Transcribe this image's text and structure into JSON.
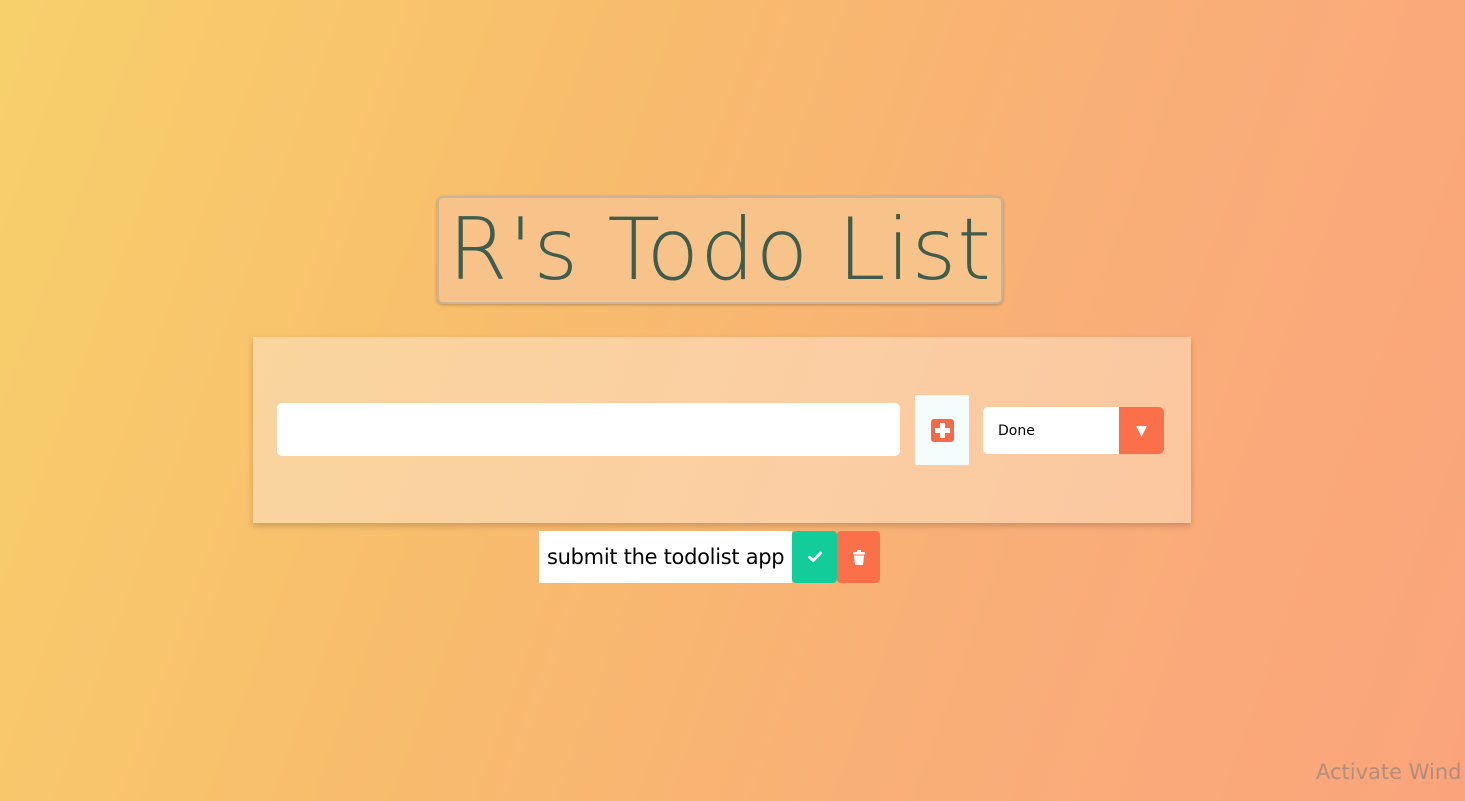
{
  "header": {
    "title": "R's Todo List"
  },
  "form": {
    "input_value": "",
    "input_placeholder": "",
    "add_icon": "plus-square-icon",
    "filter": {
      "selected": "Done",
      "arrow_icon": "triangle-down-icon"
    }
  },
  "todos": [
    {
      "text": "submit the todolist app",
      "complete_icon": "check-icon",
      "delete_icon": "trash-icon"
    }
  ],
  "watermark": {
    "text": "Activate Wind"
  },
  "colors": {
    "title_text": "#3f5d4c",
    "accent": "#fb7049",
    "complete": "#12cc9a"
  }
}
